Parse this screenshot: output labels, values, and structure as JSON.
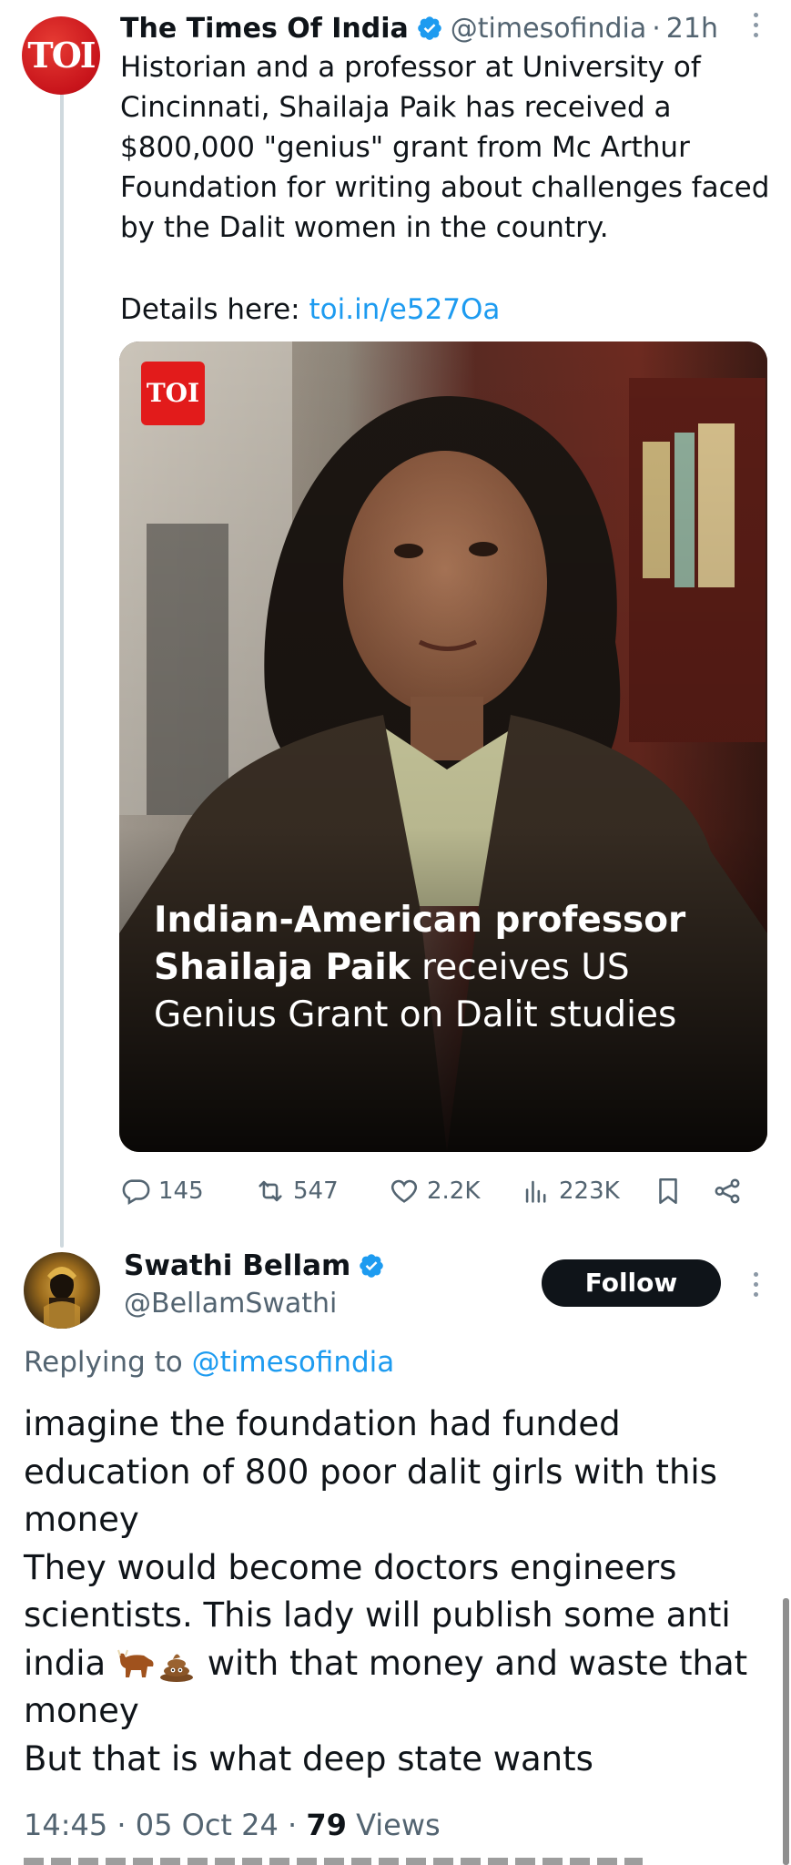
{
  "tweet": {
    "avatar_text": "TOI",
    "author_name": "The Times Of India",
    "handle": "@timesofindia",
    "separator": "·",
    "time": "21h",
    "body": "Historian and a professor at University of\nCincinnati, Shailaja Paik has received a\n$800,000 \"genius\" grant from Mc Arthur\nFoundation for writing about challenges faced\nby the Dalit women in the country.",
    "details_label": "Details here:",
    "details_link": "toi.in/e527Oa",
    "media": {
      "badge": "TOI",
      "headline_bold_1": "Indian-American professor",
      "headline_bold_2": "Shailaja Paik",
      "headline_rest_2": " receives US",
      "headline_line_3": "Genius Grant on Dalit studies"
    },
    "actions": {
      "replies": "145",
      "retweets": "547",
      "likes": "2.2K",
      "views": "223K"
    }
  },
  "reply": {
    "author_name": "Swathi Bellam",
    "handle": "@BellamSwathi",
    "follow_label": "Follow",
    "replying_prefix": "Replying to",
    "replying_to": "@timesofindia",
    "lines": {
      "l1": "imagine the foundation had funded",
      "l2": "education of 800 poor dalit girls with this",
      "l3": "money",
      "l4": "They would become doctors engineers",
      "l5": "scientists. This lady will publish some anti",
      "l6a": "india",
      "l6b": "with that money and waste that",
      "l7": "money",
      "l8": "But that is what deep state wants"
    },
    "emojis": [
      "ox",
      "pile-of-poo"
    ],
    "time": "14:45",
    "date": "05 Oct 24",
    "separator": "·",
    "views_count": "79",
    "views_label": "Views"
  },
  "colors": {
    "link": "#1d9bf0",
    "verified": "#1d9bf0",
    "muted": "#536471",
    "toi_red": "#e21b1b"
  }
}
